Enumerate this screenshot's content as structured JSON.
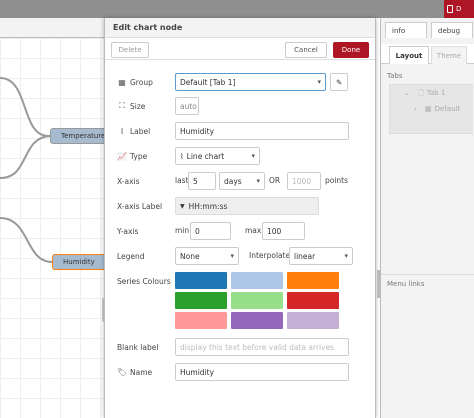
{
  "header": {
    "deploy_label": "D"
  },
  "workspace": {
    "nodes": [
      "Temperature",
      "Humidity"
    ]
  },
  "tray": {
    "title": "Edit chart node",
    "delete_label": "Delete",
    "cancel_label": "Cancel",
    "done_label": "Done",
    "group": {
      "label": "Group",
      "value": "Default [Tab 1]"
    },
    "size": {
      "label": "Size",
      "value": "auto"
    },
    "label": {
      "label": "Label",
      "value": "Humidity"
    },
    "type": {
      "label": "Type",
      "value": "Line chart"
    },
    "xaxis": {
      "label": "X-axis",
      "last": "last",
      "count": "5",
      "unit": "days",
      "or": "OR",
      "points_placeholder": "1000",
      "points": "points"
    },
    "xaxis_label": {
      "label": "X-axis Label",
      "value": "HH:mm:ss"
    },
    "yaxis": {
      "label": "Y-axis",
      "min_label": "min",
      "min": "0",
      "max_label": "max",
      "max": "100"
    },
    "legend": {
      "label": "Legend",
      "value": "None",
      "interp_label": "Interpolate",
      "interp": "linear"
    },
    "series": {
      "label": "Series Colours",
      "colors": [
        "#1f77b4",
        "#aec7e8",
        "#ff7f0e",
        "#2ca02c",
        "#98df8a",
        "#d62728",
        "#ff9896",
        "#9467bd",
        "#c5b0d5"
      ]
    },
    "blank": {
      "label": "Blank label",
      "placeholder": "display this text before valid data arrives"
    },
    "name": {
      "label": "Name",
      "value": "Humidity"
    }
  },
  "sidebar": {
    "tabs": [
      "info",
      "debug"
    ],
    "subtabs": [
      "Layout",
      "Theme"
    ],
    "tabs_header": "Tabs",
    "tree": [
      "Tab 1",
      "Default"
    ],
    "menu_links": "Menu links"
  }
}
